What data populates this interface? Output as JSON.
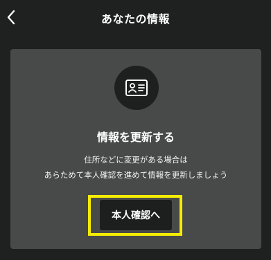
{
  "header": {
    "title": "あなたの情報",
    "back_icon": "chevron-left-icon"
  },
  "card": {
    "icon": "id-card-icon",
    "title": "情報を更新する",
    "description_lines": [
      "住所などに変更がある場合は",
      "あらためて本人確認を進めて情報を更新しましょう"
    ],
    "button_label": "本人確認へ"
  },
  "colors": {
    "background": "#1f2020",
    "card": "#484a4a",
    "button": "#1d1e1e",
    "highlight": "#f5ec00",
    "text": "#ffffff"
  }
}
